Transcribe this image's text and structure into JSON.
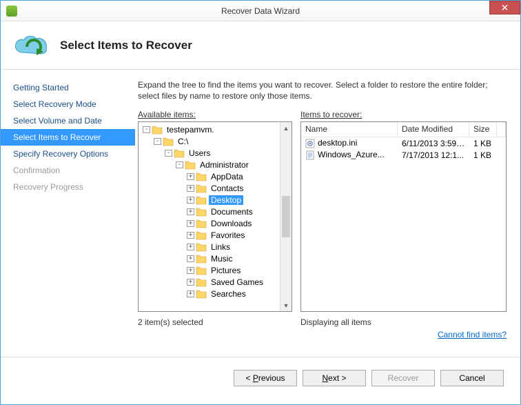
{
  "window": {
    "title": "Recover Data Wizard"
  },
  "banner": {
    "heading": "Select Items to Recover"
  },
  "sidebar": {
    "steps": [
      {
        "label": "Getting Started",
        "state": "normal"
      },
      {
        "label": "Select Recovery Mode",
        "state": "normal"
      },
      {
        "label": "Select Volume and Date",
        "state": "normal"
      },
      {
        "label": "Select Items to Recover",
        "state": "active"
      },
      {
        "label": "Specify Recovery Options",
        "state": "normal"
      },
      {
        "label": "Confirmation",
        "state": "disabled"
      },
      {
        "label": "Recovery Progress",
        "state": "disabled"
      }
    ]
  },
  "main": {
    "instructions": "Expand the tree to find the items you want to recover. Select a folder to restore the entire folder; select files by name to restore only those items.",
    "available_label": "Available items:",
    "recover_label": "Items to recover:",
    "tree": [
      {
        "depth": 0,
        "toggle": "-",
        "label": "testepamvm."
      },
      {
        "depth": 1,
        "toggle": "-",
        "label": "C:\\"
      },
      {
        "depth": 2,
        "toggle": "-",
        "label": "Users"
      },
      {
        "depth": 3,
        "toggle": "-",
        "label": "Administrator"
      },
      {
        "depth": 4,
        "toggle": "+",
        "label": "AppData"
      },
      {
        "depth": 4,
        "toggle": "+",
        "label": "Contacts"
      },
      {
        "depth": 4,
        "toggle": "+",
        "label": "Desktop",
        "selected": true
      },
      {
        "depth": 4,
        "toggle": "+",
        "label": "Documents"
      },
      {
        "depth": 4,
        "toggle": "+",
        "label": "Downloads"
      },
      {
        "depth": 4,
        "toggle": "+",
        "label": "Favorites"
      },
      {
        "depth": 4,
        "toggle": "+",
        "label": "Links"
      },
      {
        "depth": 4,
        "toggle": "+",
        "label": "Music"
      },
      {
        "depth": 4,
        "toggle": "+",
        "label": "Pictures"
      },
      {
        "depth": 4,
        "toggle": "+",
        "label": "Saved Games"
      },
      {
        "depth": 4,
        "toggle": "+",
        "label": "Searches"
      }
    ],
    "columns": {
      "name": "Name",
      "date": "Date Modified",
      "size": "Size"
    },
    "files": [
      {
        "icon": "gear",
        "name": "desktop.ini",
        "date": "6/11/2013 3:59 ...",
        "size": "1 KB"
      },
      {
        "icon": "text",
        "name": "Windows_Azure...",
        "date": "7/17/2013 12:1...",
        "size": "1 KB"
      }
    ],
    "left_status": "2 item(s) selected",
    "right_status": "Displaying all items",
    "help_link": "Cannot find items?"
  },
  "footer": {
    "previous": "< Previous",
    "next": "Next >",
    "recover": "Recover",
    "cancel": "Cancel"
  }
}
